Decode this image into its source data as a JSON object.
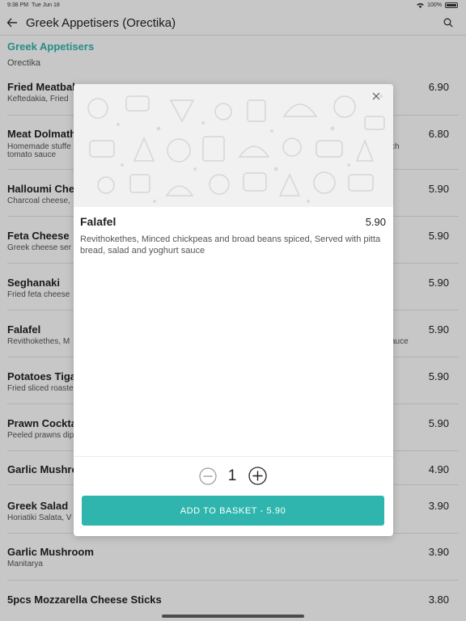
{
  "status": {
    "time": "9:38 PM",
    "date": "Tue Jun 18",
    "battery": "100%"
  },
  "header": {
    "title": "Greek Appetisers (Orectika)"
  },
  "section": {
    "title": "Greek Appetisers",
    "subtitle": "Orectika"
  },
  "menu": [
    {
      "name": "Fried Meatbal",
      "desc": "Keftedakia, Fried",
      "price": "6.90"
    },
    {
      "name": "Meat Dolmath",
      "desc": "Homemade stuffe",
      "desc2": "tomato sauce",
      "desc_right": "ch",
      "price": "6.80"
    },
    {
      "name": "Halloumi Che",
      "desc": "Charcoal cheese,",
      "price": "5.90"
    },
    {
      "name": "Feta Cheese",
      "desc": "Greek cheese ser",
      "price": "5.90"
    },
    {
      "name": "Seghanaki",
      "desc": "Fried feta cheese",
      "price": "5.90"
    },
    {
      "name": "Falafel",
      "desc": "Revithokethes, M",
      "desc_right": "auce",
      "price": "5.90"
    },
    {
      "name": "Potatoes Tiga",
      "desc": "Fried sliced roaste",
      "price": "5.90"
    },
    {
      "name": "Prawn Cockta",
      "desc": "Peeled prawns dip",
      "price": "5.90"
    },
    {
      "name": "Garlic Mushro",
      "desc": "",
      "price": "4.90"
    },
    {
      "name": "Greek Salad",
      "desc": "Horiatiki Salata, V",
      "price": "3.90"
    },
    {
      "name": "Garlic Mushroom",
      "desc": "Manitarya",
      "price": "3.90"
    },
    {
      "name": "5pcs Mozzarella Cheese Sticks",
      "desc": "",
      "price": "3.80"
    }
  ],
  "modal": {
    "item_name": "Falafel",
    "item_price": "5.90",
    "item_description": "Revithokethes, Minced chickpeas and broad beans spiced, Served with pitta bread, salad and yoghurt sauce",
    "quantity": "1",
    "add_button_label": "ADD TO BASKET  -  5.90"
  },
  "colors": {
    "accent": "#2fb5ad"
  },
  "icons": {
    "back": "arrow-left-icon",
    "search": "search-icon",
    "close": "close-icon",
    "minus": "minus-circle-icon",
    "plus": "plus-circle-icon",
    "wifi": "wifi-icon",
    "battery": "battery-icon"
  }
}
